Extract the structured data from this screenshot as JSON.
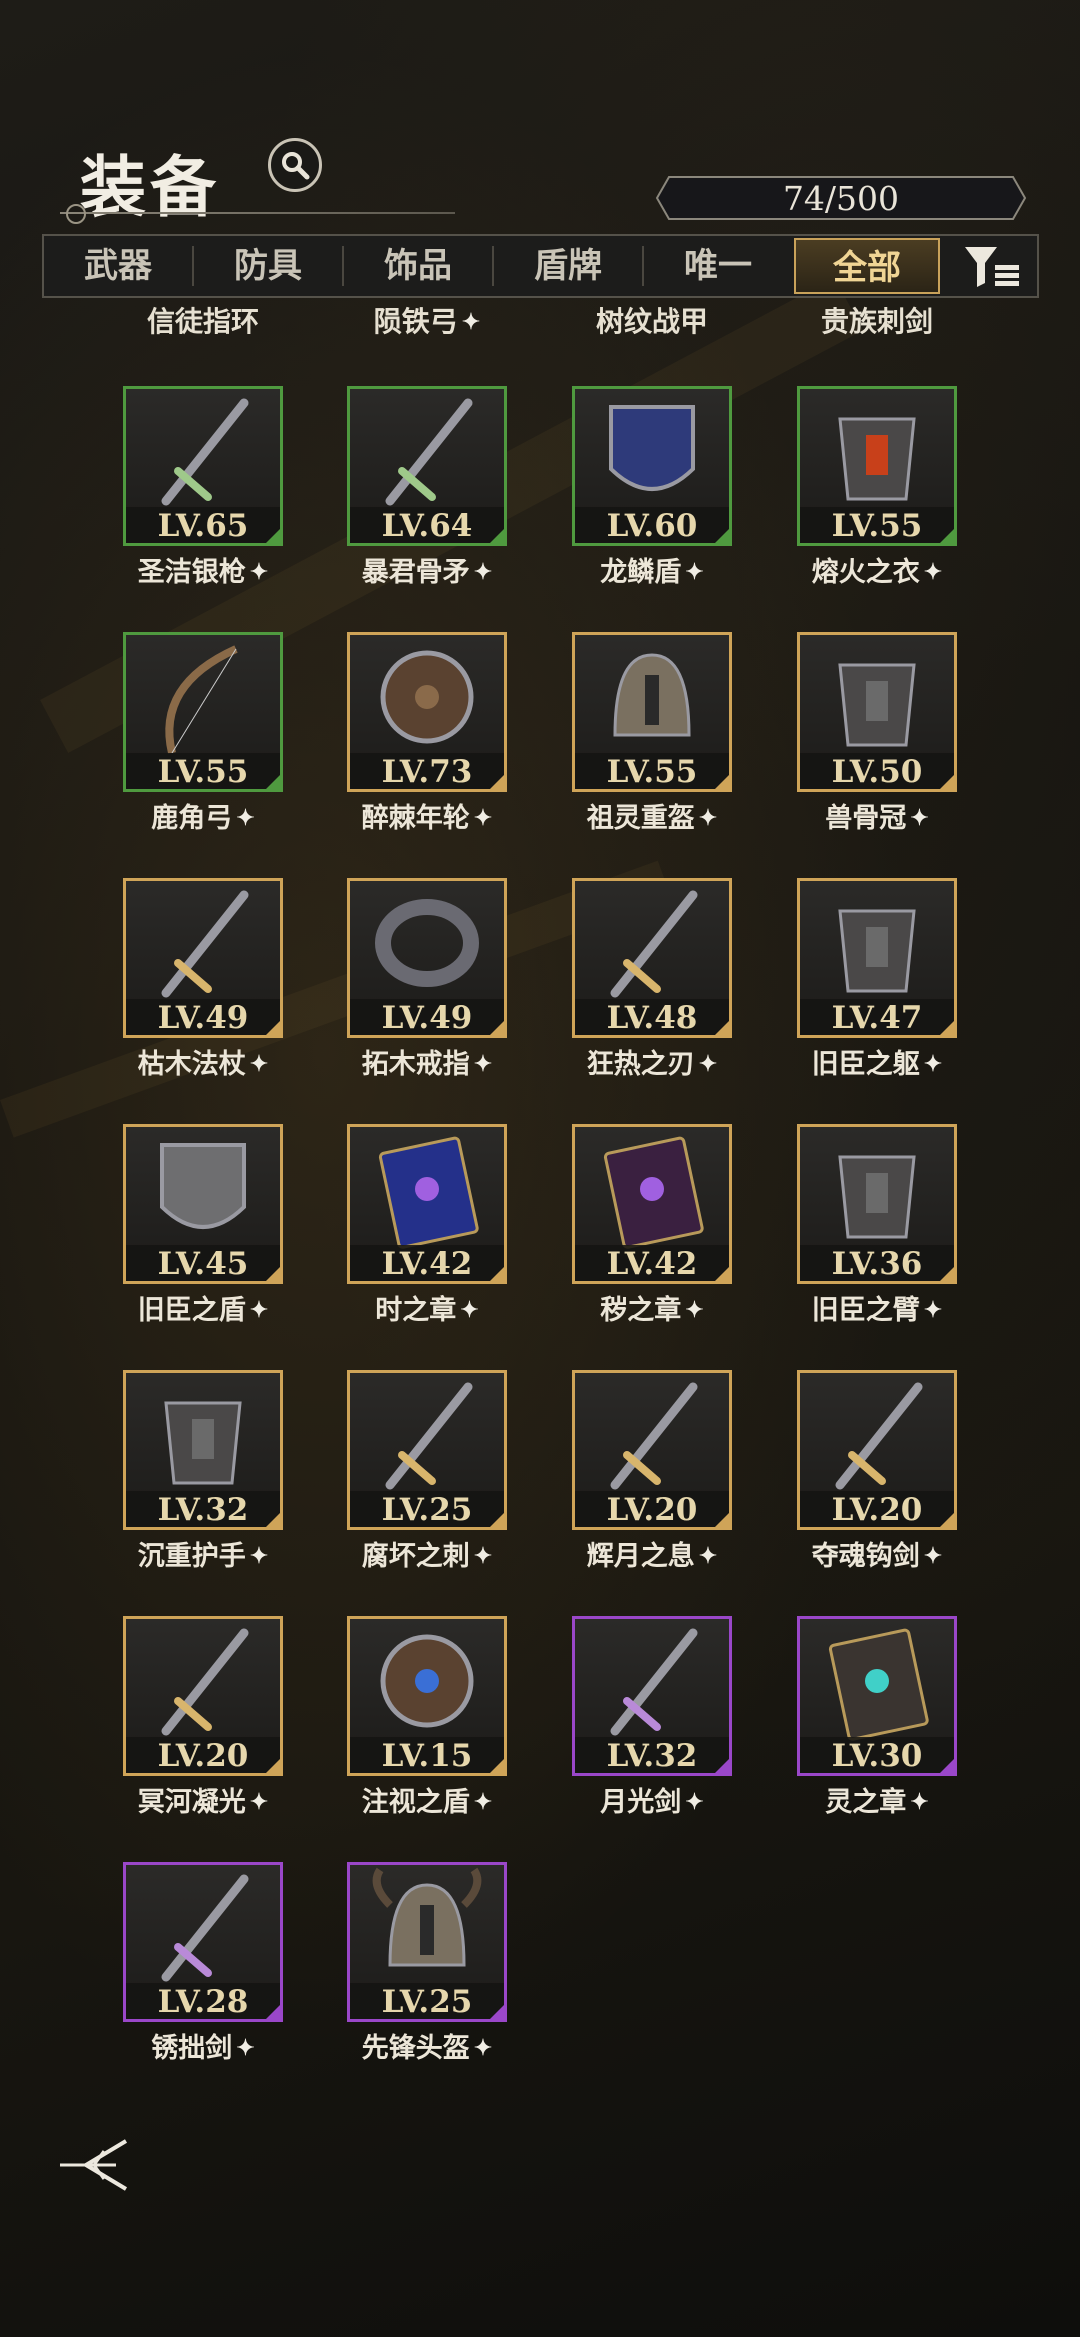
{
  "header": {
    "title": "装备",
    "count": "74/500"
  },
  "tabs": [
    {
      "label": "武器",
      "active": false
    },
    {
      "label": "防具",
      "active": false
    },
    {
      "label": "饰品",
      "active": false
    },
    {
      "label": "盾牌",
      "active": false
    },
    {
      "label": "唯一",
      "active": false
    },
    {
      "label": "全部",
      "active": true
    }
  ],
  "colors": {
    "green": "#4f9a3f",
    "gold": "#cfa458",
    "purple": "#9a47c9",
    "accent": "#f0d595"
  },
  "partial_row": [
    {
      "name": "信徒指环",
      "star": false
    },
    {
      "name": "陨铁弓",
      "star": true
    },
    {
      "name": "树纹战甲",
      "star": false
    },
    {
      "name": "贵族刺剑",
      "star": false
    }
  ],
  "items": [
    {
      "level": "LV.65",
      "name": "圣洁银枪",
      "rarity": "green",
      "icon": "spear-icon"
    },
    {
      "level": "LV.64",
      "name": "暴君骨矛",
      "rarity": "green",
      "icon": "bone-spear-icon"
    },
    {
      "level": "LV.60",
      "name": "龙鳞盾",
      "rarity": "green",
      "icon": "dragon-shield-icon"
    },
    {
      "level": "LV.55",
      "name": "熔火之衣",
      "rarity": "green",
      "icon": "lava-armor-icon"
    },
    {
      "level": "LV.55",
      "name": "鹿角弓",
      "rarity": "green",
      "icon": "bow-icon"
    },
    {
      "level": "LV.73",
      "name": "醉棘年轮",
      "rarity": "gold",
      "icon": "round-shield-icon"
    },
    {
      "level": "LV.55",
      "name": "祖灵重盔",
      "rarity": "gold",
      "icon": "helmet-icon"
    },
    {
      "level": "LV.50",
      "name": "兽骨冠",
      "rarity": "gold",
      "icon": "antler-crown-icon"
    },
    {
      "level": "LV.49",
      "name": "枯木法杖",
      "rarity": "gold",
      "icon": "staff-icon"
    },
    {
      "level": "LV.49",
      "name": "拓木戒指",
      "rarity": "gold",
      "icon": "ring-icon"
    },
    {
      "level": "LV.48",
      "name": "狂热之刃",
      "rarity": "gold",
      "icon": "sword-icon"
    },
    {
      "level": "LV.47",
      "name": "旧臣之躯",
      "rarity": "gold",
      "icon": "chest-armor-icon"
    },
    {
      "level": "LV.45",
      "name": "旧臣之盾",
      "rarity": "gold",
      "icon": "tower-shield-icon"
    },
    {
      "level": "LV.42",
      "name": "时之章",
      "rarity": "gold",
      "icon": "tome-icon"
    },
    {
      "level": "LV.42",
      "name": "秽之章",
      "rarity": "gold",
      "icon": "dark-tome-icon"
    },
    {
      "level": "LV.36",
      "name": "旧臣之臂",
      "rarity": "gold",
      "icon": "gauntlet-icon"
    },
    {
      "level": "LV.32",
      "name": "沉重护手",
      "rarity": "gold",
      "icon": "bracer-icon"
    },
    {
      "level": "LV.25",
      "name": "腐坏之刺",
      "rarity": "gold",
      "icon": "thorn-dagger-icon"
    },
    {
      "level": "LV.20",
      "name": "辉月之息",
      "rarity": "gold",
      "icon": "moon-sword-icon"
    },
    {
      "level": "LV.20",
      "name": "夺魂钩剑",
      "rarity": "gold",
      "icon": "hook-sword-icon"
    },
    {
      "level": "LV.20",
      "name": "冥河凝光",
      "rarity": "gold",
      "icon": "crystal-staff-icon"
    },
    {
      "level": "LV.15",
      "name": "注视之盾",
      "rarity": "gold",
      "icon": "eye-shield-icon"
    },
    {
      "level": "LV.32",
      "name": "月光剑",
      "rarity": "purple",
      "icon": "moonlight-sword-icon"
    },
    {
      "level": "LV.30",
      "name": "灵之章",
      "rarity": "purple",
      "icon": "spirit-tome-icon"
    },
    {
      "level": "LV.28",
      "name": "锈拙剑",
      "rarity": "purple",
      "icon": "rusty-sword-icon"
    },
    {
      "level": "LV.25",
      "name": "先锋头盔",
      "rarity": "purple",
      "icon": "horned-helmet-icon"
    }
  ]
}
